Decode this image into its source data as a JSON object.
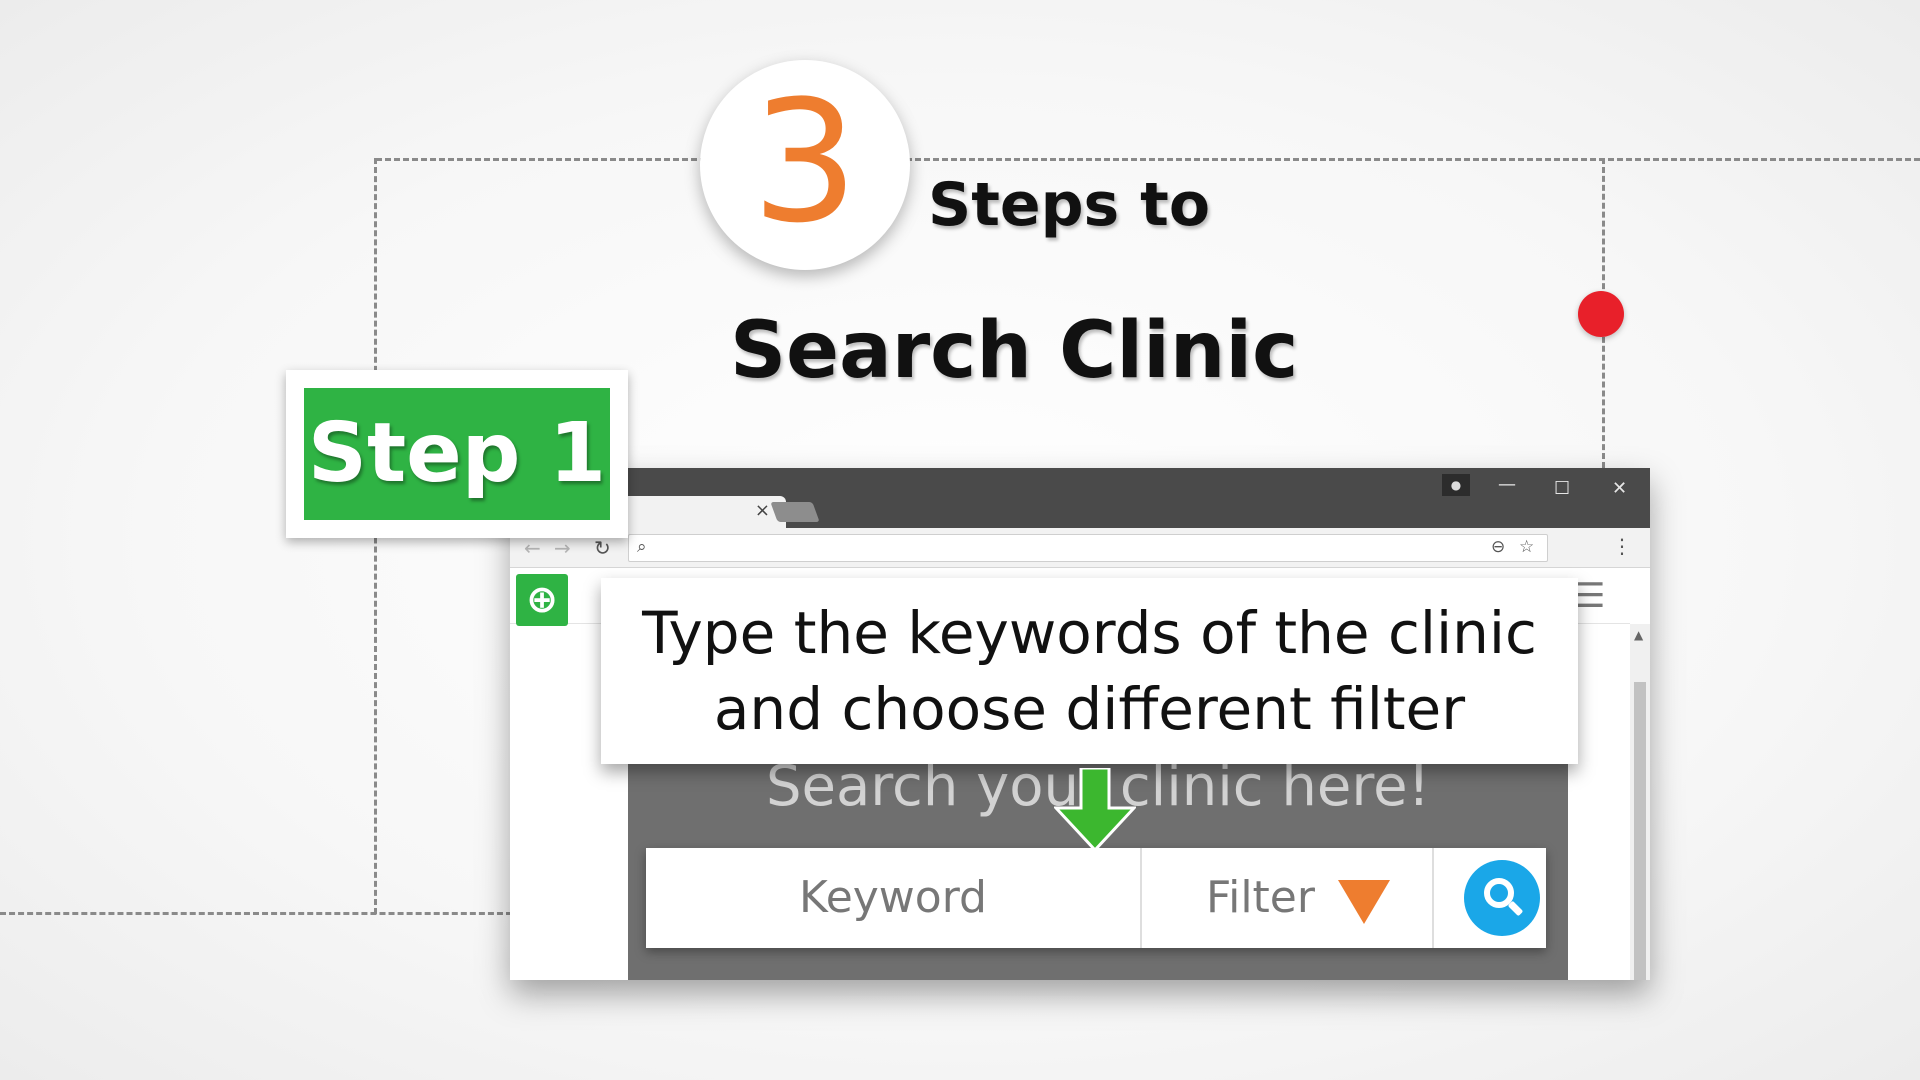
{
  "title": {
    "number": "3",
    "line1": "Steps to",
    "line2": "Search Clinic"
  },
  "step_badge": {
    "label": "Step 1"
  },
  "callout": {
    "line1": "Type the keywords of the clinic",
    "line2": "and choose different filter"
  },
  "browser": {
    "tab_close": "×",
    "controls": {
      "minimize": "—",
      "maximize": "☐",
      "close": "✕"
    }
  },
  "page": {
    "hero_title": "Search your clinic here!",
    "search": {
      "keyword_placeholder": "Keyword",
      "filter_label": "Filter"
    }
  },
  "colors": {
    "accent_orange": "#ee7d2f",
    "step_green": "#2fb344",
    "search_blue": "#1aa7e8",
    "marker_red": "#e8202a"
  },
  "icons": [
    "back-icon",
    "forward-icon",
    "reload-icon",
    "search-icon",
    "zoom-icon",
    "star-icon",
    "menu-dots-icon",
    "clinic-logo-icon",
    "hamburger-icon",
    "dropdown-arrow-icon",
    "down-arrow-icon"
  ]
}
